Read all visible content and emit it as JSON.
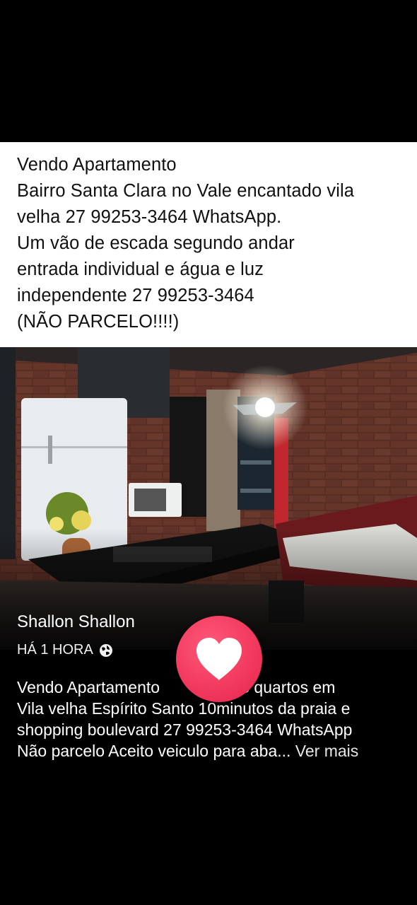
{
  "post_text": {
    "lines": [
      "Vendo Apartamento",
      "Bairro Santa Clara no Vale encantado vila",
      "velha 27 99253-3464 WhatsApp.",
      "Um vão de escada segundo andar",
      "entrada individual e água e luz",
      "independente 27 99253-3464",
      "(NÃO PARCELO!!!!)"
    ]
  },
  "photo": {
    "subject": "apartment-interior-photo"
  },
  "author": {
    "name": "Shallon Shallon",
    "time": "HÁ 1 HORA",
    "privacy_icon": "globe-icon"
  },
  "description": {
    "line1_start": "Vendo Apartamento ",
    "line1_end": "o3 quartos em",
    "line2": "Vila velha Espírito Santo 10minutos da praia e",
    "line3": "shopping boulevard 27 99253-3464 WhatsApp",
    "line4": "Não parcelo Aceito veiculo para aba...",
    "see_more": "Ver mais"
  },
  "reaction": {
    "icon": "heart-icon",
    "color": "#f23a5e"
  }
}
